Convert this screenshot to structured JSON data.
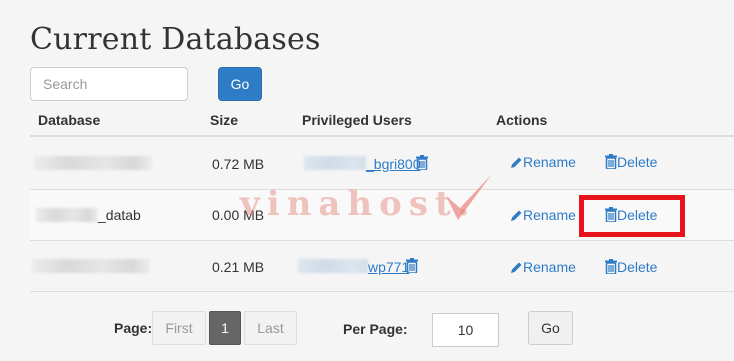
{
  "page": {
    "title": "Current Databases"
  },
  "search": {
    "placeholder": "Search",
    "go_label": "Go"
  },
  "table": {
    "headers": {
      "database": "Database",
      "size": "Size",
      "users": "Privileged Users",
      "actions": "Actions"
    },
    "rows": [
      {
        "database": "",
        "size": "0.72 MB",
        "user": "_bgri800",
        "rename": "Rename",
        "delete": "Delete"
      },
      {
        "database": "_datab",
        "size": "0.00 MB",
        "user": "",
        "rename": "Rename",
        "delete": "Delete"
      },
      {
        "database": "",
        "size": "0.21 MB",
        "user": "wp771",
        "rename": "Rename",
        "delete": "Delete"
      }
    ]
  },
  "pagination": {
    "page_label": "Page:",
    "first_label": "First",
    "current_page": "1",
    "last_label": "Last",
    "per_page_label": "Per Page:",
    "per_page_value": "10",
    "go_label": "Go"
  },
  "watermark": {
    "text": "vinahost."
  },
  "colors": {
    "accent": "#2e7cc6",
    "highlight": "#e8141b"
  }
}
